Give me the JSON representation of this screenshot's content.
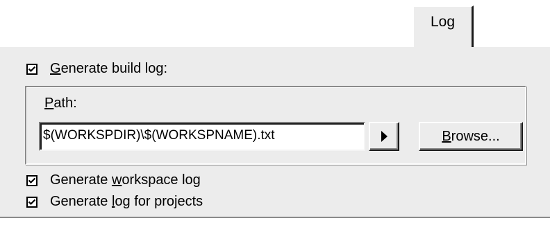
{
  "tabs": [
    {
      "label": "Log",
      "selected": true
    }
  ],
  "log_settings": {
    "generate_build_log": {
      "label_prefix": "",
      "label_accel": "G",
      "label_rest": "enerate build log:",
      "checked": true
    },
    "path_group": {
      "label_accel": "P",
      "label_rest": "ath:",
      "path_value": "$(WORKSPDIR)\\$(WORKSPNAME).txt",
      "browse_accel": "B",
      "browse_rest": "rowse...",
      "arrow_icon": "right-triangle-arrow"
    },
    "generate_workspace_log": {
      "label_prefix": "Generate ",
      "label_accel": "w",
      "label_rest": "orkspace log",
      "checked": true
    },
    "generate_log_for_projects": {
      "label_prefix": "Generate ",
      "label_accel": "l",
      "label_rest": "og for projects",
      "checked": true
    }
  },
  "colors": {
    "panel_face": "#ececec",
    "highlight": "#ffffff",
    "shadow": "#8a8a8a",
    "dark_shadow": "#1a1a1a"
  }
}
